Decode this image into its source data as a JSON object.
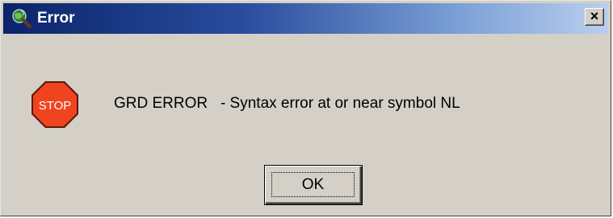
{
  "window": {
    "title": "Error",
    "close_label": "×",
    "app_icon": "globe-magnifier-icon"
  },
  "dialog": {
    "stop_icon": "stop-sign-icon",
    "stop_label": "STOP",
    "message": "GRD ERROR   - Syntax error at or near symbol NL",
    "ok_label": "OK"
  },
  "colors": {
    "titlebar_start": "#0a246a",
    "titlebar_end": "#b9cfee",
    "dialog_bg": "#d4d0c8",
    "stop_red": "#f0441e"
  }
}
